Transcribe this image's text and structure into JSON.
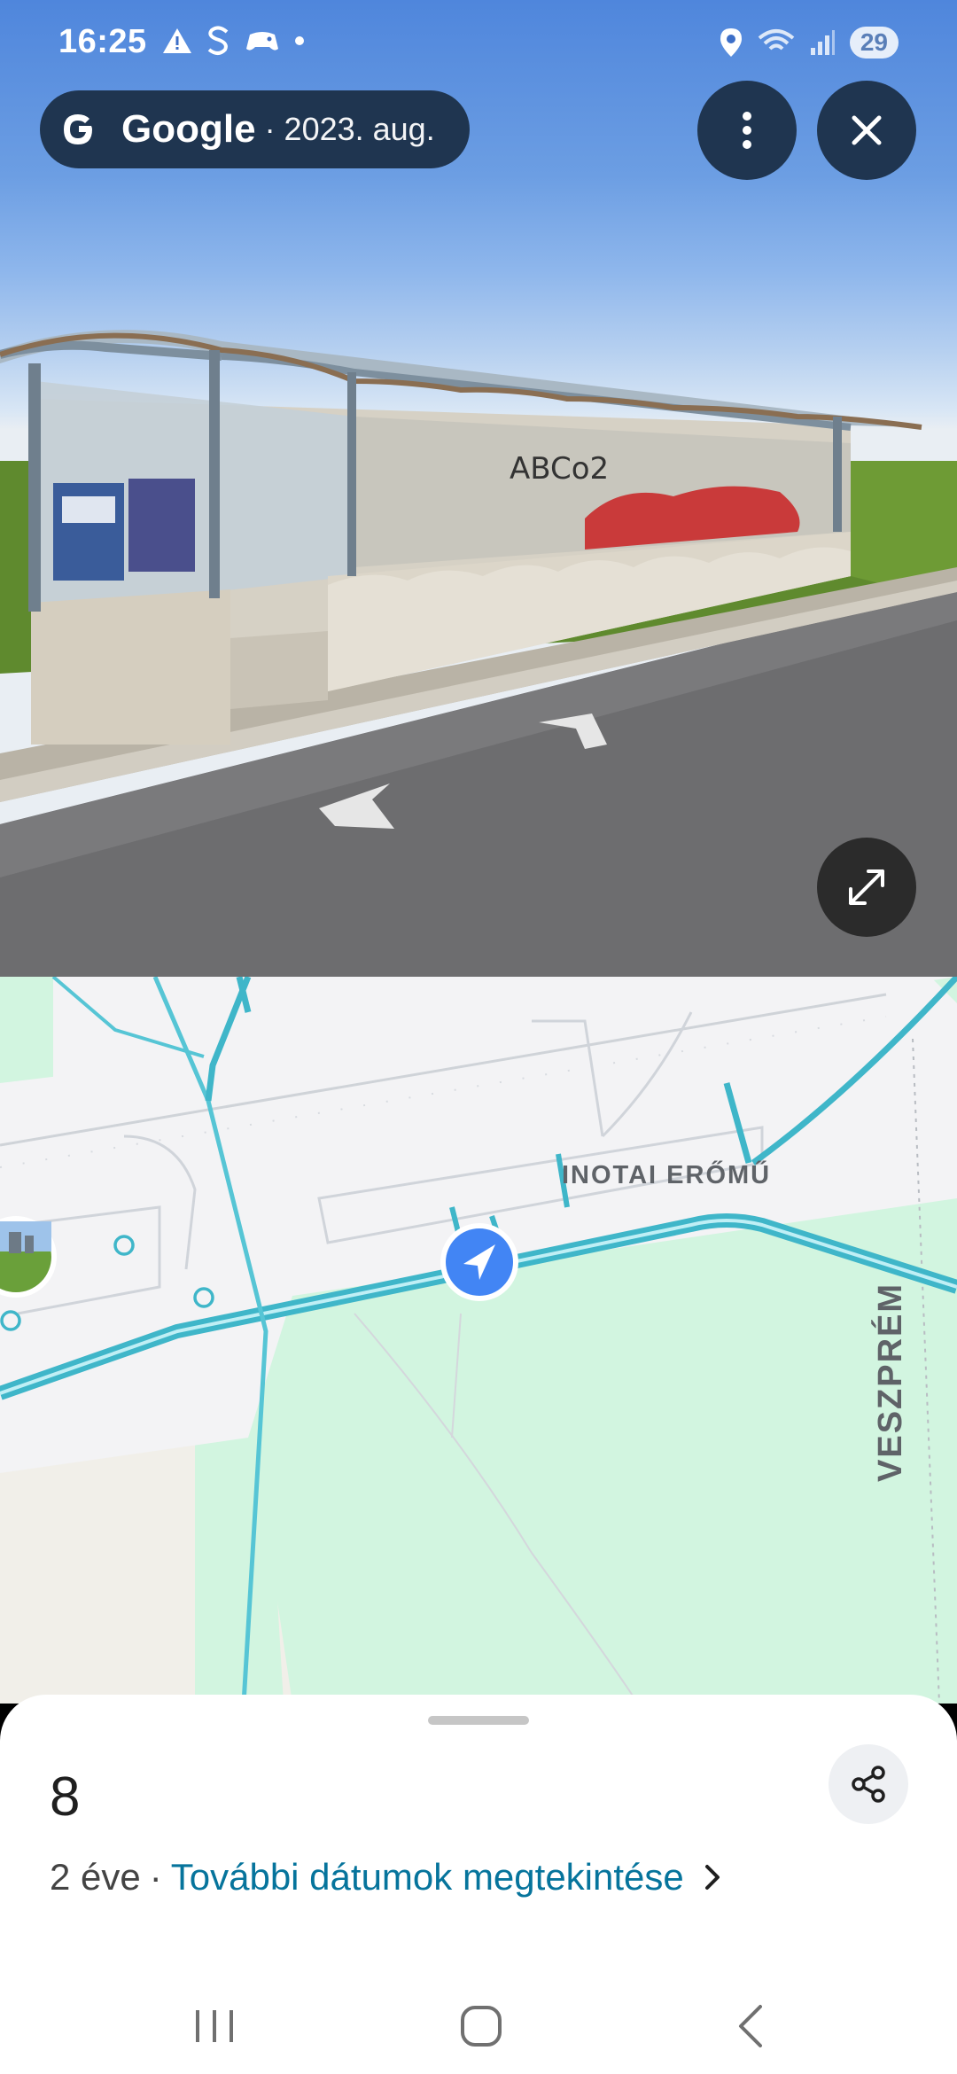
{
  "status_bar": {
    "time": "16:25",
    "battery": "29",
    "icons": [
      "warning-icon",
      "s-icon",
      "controller-icon",
      "dot-icon",
      "location-icon",
      "wifi-icon",
      "signal-icon"
    ]
  },
  "top_bar": {
    "brand": "Google",
    "date": "· 2023. aug.",
    "more_icon": "more-vert-icon",
    "close_icon": "close-icon"
  },
  "map": {
    "labels": {
      "inotai": "INOTAI ERŐMŰ",
      "veszprem": "VESZPRÉM"
    }
  },
  "sheet": {
    "title": "8",
    "age": "2 éve",
    "separator": "·",
    "link": "További dátumok megtekintése"
  },
  "colors": {
    "map_water": "#3fb6c9",
    "map_green": "#d2f5e0",
    "link": "#06749c",
    "marker": "#4285f4",
    "pill_bg": "#1f3550"
  }
}
